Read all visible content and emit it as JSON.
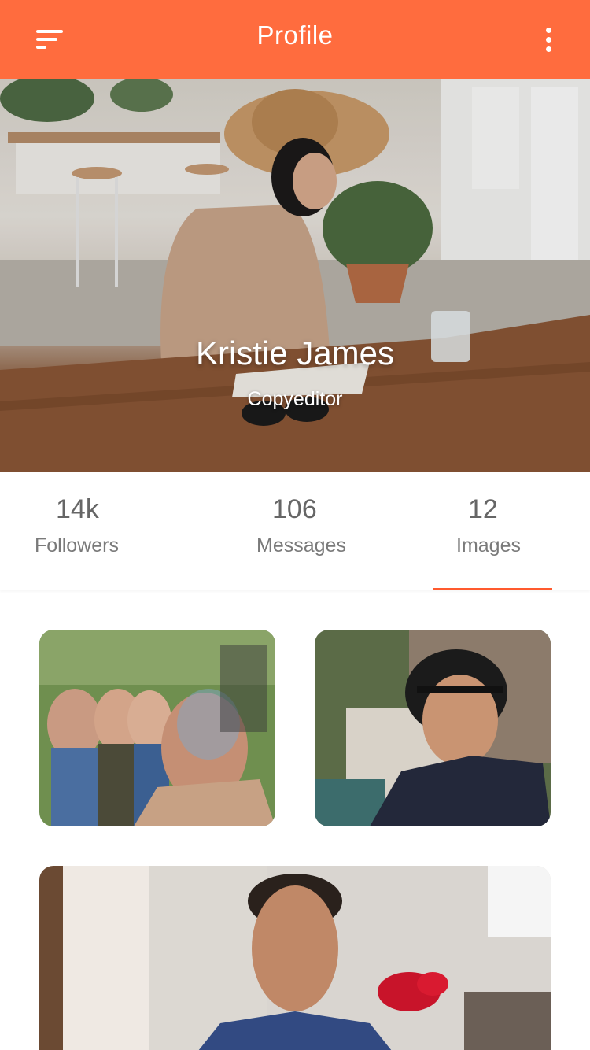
{
  "header": {
    "title": "Profile",
    "menu_icon": "hamburger-menu-icon",
    "more_icon": "more-vertical-icon",
    "background": "#ff6c3e"
  },
  "profile": {
    "name": "Kristie James",
    "role": "Copyeditor"
  },
  "stats": [
    {
      "value": "14k",
      "label": "Followers"
    },
    {
      "value": "106",
      "label": "Messages"
    },
    {
      "value": "12",
      "label": "Images"
    }
  ],
  "active_tab": "Images",
  "accent_color": "#ff5a2e"
}
